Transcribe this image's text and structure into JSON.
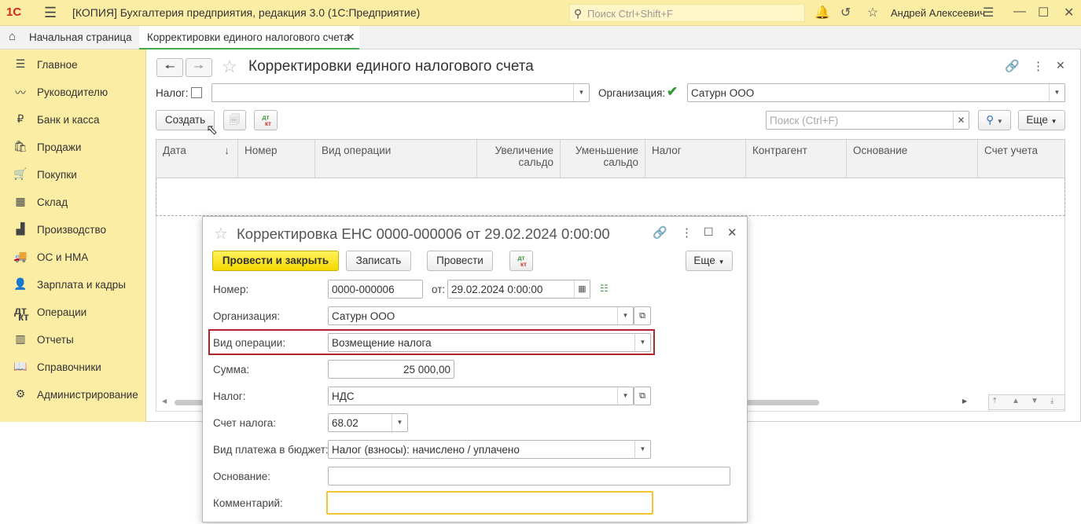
{
  "titlebar": {
    "logo": "1С",
    "app_title": "[КОПИЯ] Бухгалтерия предприятия, редакция 3.0  (1С:Предприятие)",
    "search_placeholder": "Поиск Ctrl+Shift+F",
    "user": "Андрей Алексеевич"
  },
  "tabs": {
    "home": "Начальная страница",
    "active": "Корректировки единого налогового счета"
  },
  "sidebar": {
    "items": [
      {
        "label": "Главное",
        "icon": "menu-icon"
      },
      {
        "label": "Руководителю",
        "icon": "trend-icon"
      },
      {
        "label": "Банк и касса",
        "icon": "ruble-icon"
      },
      {
        "label": "Продажи",
        "icon": "bag-icon"
      },
      {
        "label": "Покупки",
        "icon": "cart-icon"
      },
      {
        "label": "Склад",
        "icon": "warehouse-icon"
      },
      {
        "label": "Производство",
        "icon": "factory-icon"
      },
      {
        "label": "ОС и НМА",
        "icon": "truck-icon"
      },
      {
        "label": "Зарплата и кадры",
        "icon": "people-icon"
      },
      {
        "label": "Операции",
        "icon": "dt-kt-icon"
      },
      {
        "label": "Отчеты",
        "icon": "bar-chart-icon"
      },
      {
        "label": "Справочники",
        "icon": "book-icon"
      },
      {
        "label": "Администрирование",
        "icon": "gear-icon"
      }
    ]
  },
  "main": {
    "title": "Корректировки единого налогового счета",
    "tax_label": "Налог:",
    "tax_value": "",
    "org_label": "Организация:",
    "org_value": "Сатурн ООО",
    "create_label": "Создать",
    "search_placeholder": "Поиск (Ctrl+F)",
    "more_label": "Еще",
    "columns": [
      {
        "label": "Дата",
        "sort": "↓"
      },
      {
        "label": "Номер"
      },
      {
        "label": "Вид операции"
      },
      {
        "label": "Увеличение сальдо"
      },
      {
        "label": "Уменьшение сальдо"
      },
      {
        "label": "Налог"
      },
      {
        "label": "Контрагент"
      },
      {
        "label": "Основание"
      },
      {
        "label": "Счет учета"
      }
    ]
  },
  "popup": {
    "title": "Корректировка ЕНС 0000-000006 от 29.02.2024 0:00:00",
    "btn_post_close": "Провести и закрыть",
    "btn_write": "Записать",
    "btn_post": "Провести",
    "btn_more": "Еще",
    "number_label": "Номер:",
    "number_value": "0000-000006",
    "from_label": "от:",
    "date_value": "29.02.2024  0:00:00",
    "org_label": "Организация:",
    "org_value": "Сатурн ООО",
    "optype_label": "Вид операции:",
    "optype_value": "Возмещение налога",
    "sum_label": "Сумма:",
    "sum_value": "25 000,00",
    "tax_label": "Налог:",
    "tax_value": "НДС",
    "taxacc_label": "Счет налога:",
    "taxacc_value": "68.02",
    "paytype_label": "Вид платежа в бюджет:",
    "paytype_value": "Налог (взносы): начислено / уплачено",
    "basis_label": "Основание:",
    "basis_value": "",
    "comment_label": "Комментарий:",
    "comment_value": ""
  },
  "colors": {
    "accent_yellow": "#fbeda4",
    "tab_active": "#49a94a",
    "highlight": "#b0242b",
    "primary_button": "#f6d800"
  }
}
